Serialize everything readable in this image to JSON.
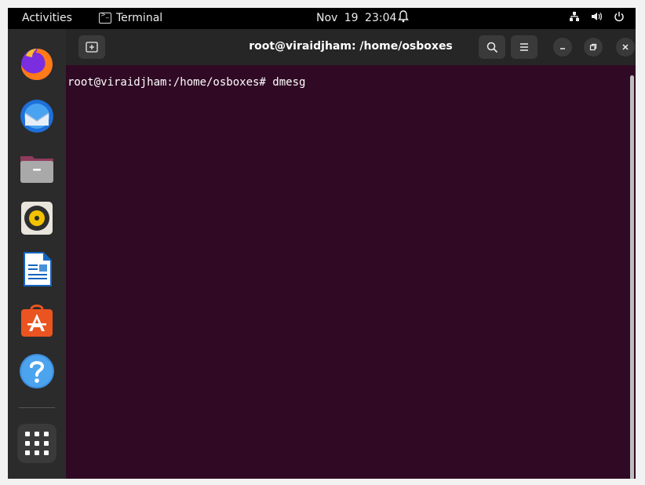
{
  "topbar": {
    "activities": "Activities",
    "app_name": "Terminal",
    "date": "Nov 19",
    "time": "23:04"
  },
  "dock": {
    "items": [
      {
        "name": "firefox-icon"
      },
      {
        "name": "thunderbird-icon"
      },
      {
        "name": "files-icon"
      },
      {
        "name": "rhythmbox-icon"
      },
      {
        "name": "libreoffice-writer-icon"
      },
      {
        "name": "ubuntu-software-icon"
      },
      {
        "name": "help-icon"
      }
    ],
    "show_apps": "show-applications-icon"
  },
  "window": {
    "title": "root@viraidjham: /home/osboxes",
    "terminal_lines": [
      "root@viraidjham:/home/osboxes# dmesg"
    ]
  },
  "colors": {
    "terminal_bg": "#300a24",
    "headerbar_bg": "#262626",
    "dock_bg": "#2b2b2b",
    "topbar_bg": "#000000"
  }
}
